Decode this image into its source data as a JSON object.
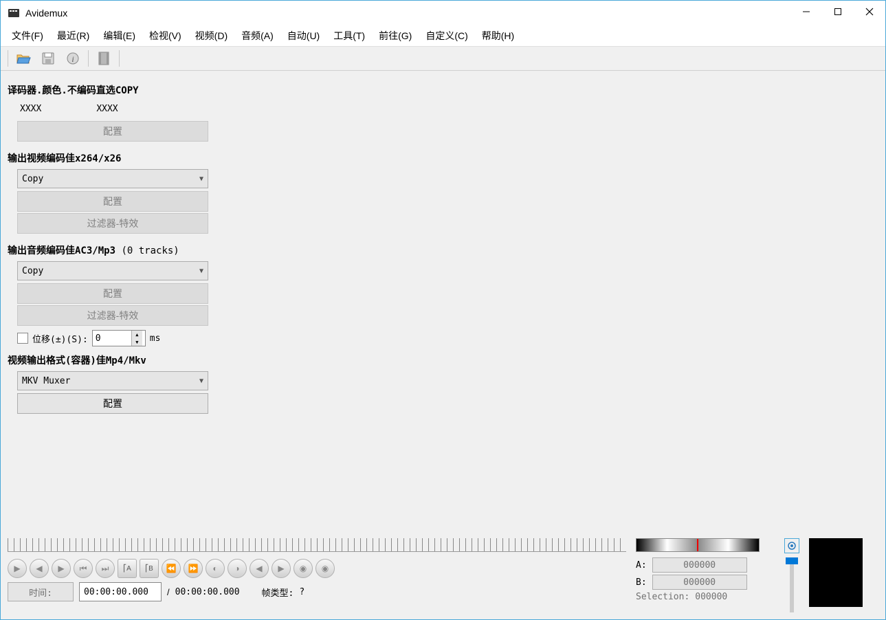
{
  "title": "Avidemux",
  "menu": [
    "文件(F)",
    "最近(R)",
    "编辑(E)",
    "检视(V)",
    "视频(D)",
    "音频(A)",
    "自动(U)",
    "工具(T)",
    "前往(G)",
    "自定义(C)",
    "帮助(H)"
  ],
  "section_decoder": "译码器.颜色.不编码直选COPY",
  "xxxx1": "XXXX",
  "xxxx2": "XXXX",
  "configure": "配置",
  "section_video": "输出视频编码佳x264/x26",
  "video_codec": "Copy",
  "filters": "过滤器-特效",
  "section_audio_prefix": "输出音频编码佳AC3/Mp3 ",
  "section_audio_tracks": "(0 tracks)",
  "audio_codec": "Copy",
  "shift_label": "位移(±)(S):",
  "shift_value": "0",
  "shift_unit": "ms",
  "section_format": "视频输出格式(容器)佳Mp4/Mkv",
  "muxer": "MKV Muxer",
  "time_label": "时间:",
  "time_current": "00:00:00.000",
  "time_sep": "/",
  "time_total": "00:00:00.000",
  "frame_type_label": "帧类型:",
  "frame_type_value": "?",
  "a_label": "A:",
  "a_value": "000000",
  "b_label": "B:",
  "b_value": "000000",
  "selection_label": "Selection:",
  "selection_value": "000000"
}
